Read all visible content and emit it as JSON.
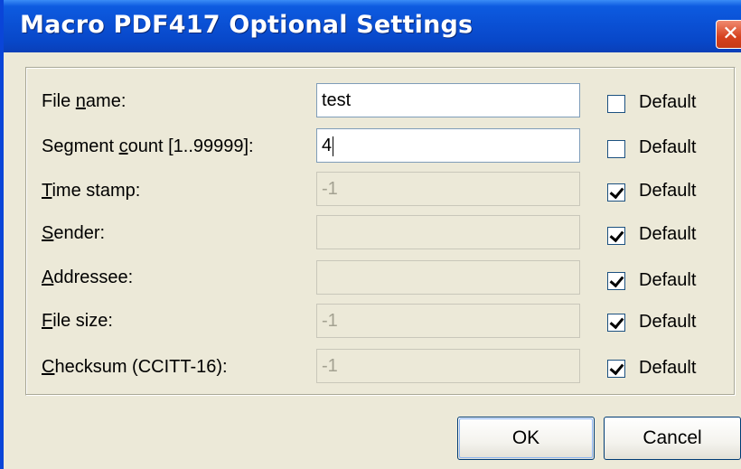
{
  "window": {
    "title": "Macro PDF417 Optional Settings",
    "close_glyph": "✕"
  },
  "fields": [
    {
      "label_pre": "File ",
      "label_u": "n",
      "label_post": "ame:",
      "value": "test",
      "enabled": true,
      "default_checked": false
    },
    {
      "label_pre": "Segment ",
      "label_u": "c",
      "label_post": "ount [1..99999]:",
      "value": "4",
      "enabled": true,
      "default_checked": false
    },
    {
      "label_pre": "",
      "label_u": "T",
      "label_post": "ime stamp:",
      "value": "-1",
      "enabled": false,
      "default_checked": true
    },
    {
      "label_pre": "",
      "label_u": "S",
      "label_post": "ender:",
      "value": "",
      "enabled": false,
      "default_checked": true
    },
    {
      "label_pre": "",
      "label_u": "A",
      "label_post": "ddressee:",
      "value": "",
      "enabled": false,
      "default_checked": true
    },
    {
      "label_pre": "",
      "label_u": "F",
      "label_post": "ile size:",
      "value": "-1",
      "enabled": false,
      "default_checked": true
    },
    {
      "label_pre": "",
      "label_u": "C",
      "label_post": "hecksum (CCITT-16):",
      "value": "-1",
      "enabled": false,
      "default_checked": true
    }
  ],
  "default_label": "Default",
  "buttons": {
    "ok": "OK",
    "cancel": "Cancel"
  }
}
